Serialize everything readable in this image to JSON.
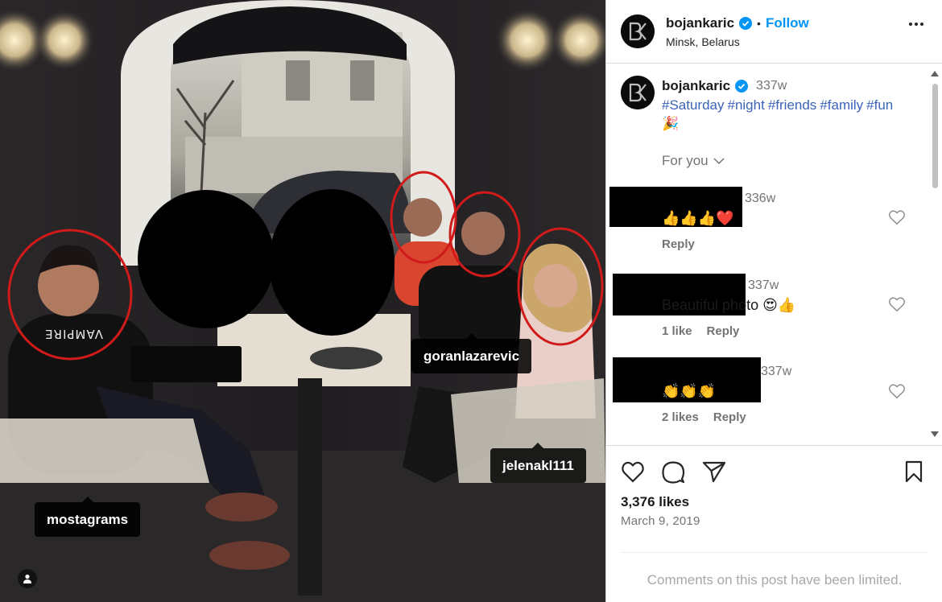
{
  "photo": {
    "tags": [
      {
        "id": "goran",
        "label": "goranlazarevic"
      },
      {
        "id": "jelena",
        "label": "jelenakl111"
      },
      {
        "id": "mosta",
        "label": "mostagrams"
      }
    ],
    "shirt_text": "VAMPIRE"
  },
  "header": {
    "avatar_text": "BK",
    "username": "bojankaric",
    "separator": "•",
    "follow_label": "Follow",
    "location": "Minsk, Belarus"
  },
  "caption": {
    "username": "bojankaric",
    "time": "337w",
    "hashtags": [
      "#Saturday",
      "#night",
      "#friends",
      "#family",
      "#fun"
    ],
    "emoji": "🎉"
  },
  "for_you": "For you",
  "comments": [
    {
      "time": "336w",
      "text": "👍👍👍❤️",
      "likes": "",
      "reply": "Reply"
    },
    {
      "time": "337w",
      "text": "Beautiful photo 😍👍",
      "likes": "1 like",
      "reply": "Reply"
    },
    {
      "time": "337w",
      "text": "👏👏👏",
      "likes": "2 likes",
      "reply": "Reply"
    }
  ],
  "footer": {
    "likes": "3,376 likes",
    "date": "March 9, 2019",
    "limited": "Comments on this post have been limited."
  },
  "colors": {
    "accent": "#0095f6",
    "hashtag": "#3c63b8",
    "circle": "#d11a1a"
  }
}
